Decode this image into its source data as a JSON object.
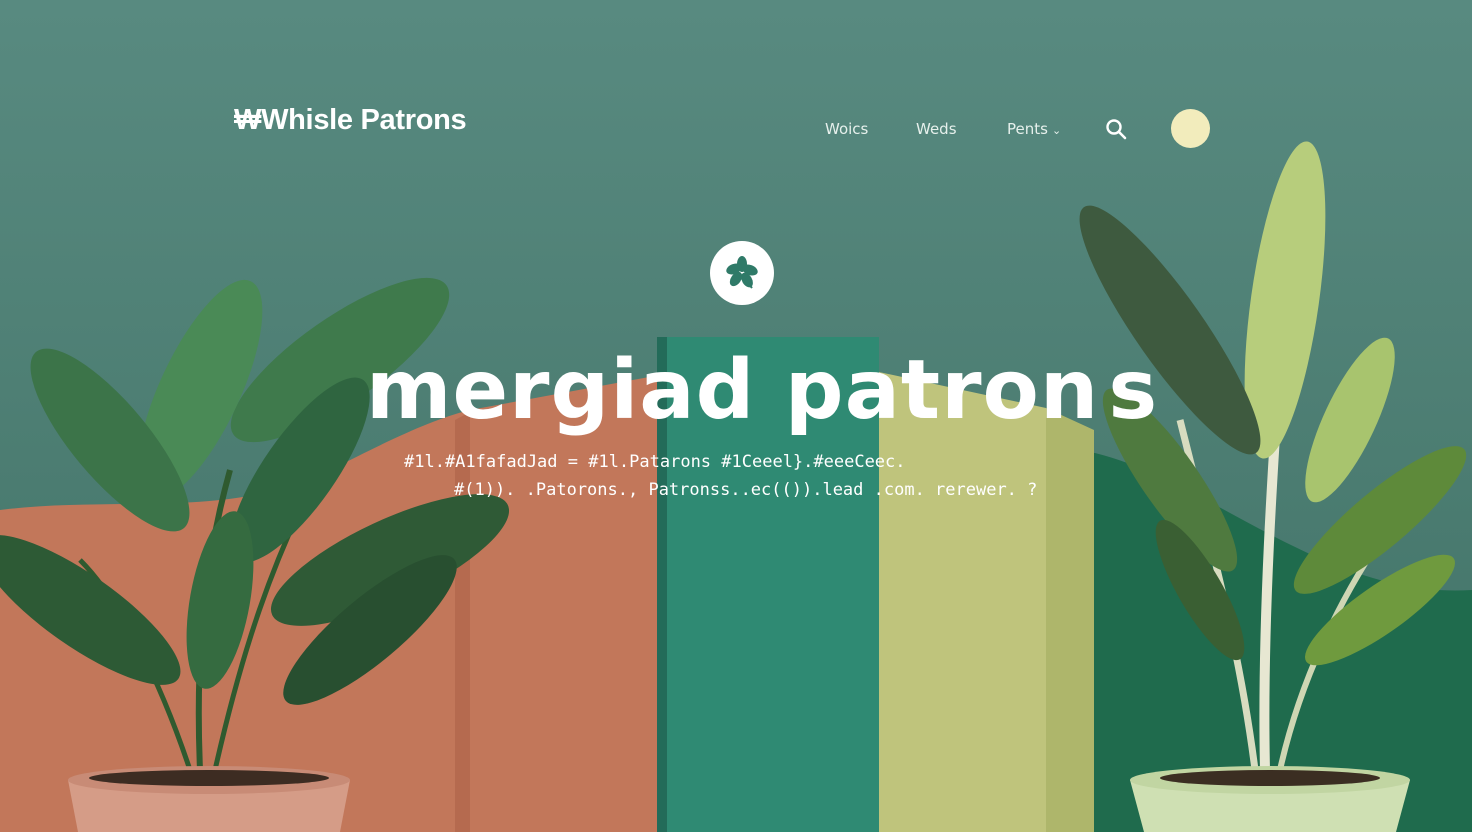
{
  "header": {
    "logo": "₩Whisle Patrons",
    "nav": [
      {
        "label": "Woics"
      },
      {
        "label": "Weds"
      },
      {
        "label": "Pents",
        "has_dropdown": true
      }
    ],
    "search_icon": "search-icon",
    "avatar_color": "#f2ecbc"
  },
  "hero": {
    "badge_icon": "flower-icon",
    "headline": "mergiad patron s",
    "tagline_1": "#1l.#A1fafadJad  = #1l.Patarons #1Ceeel}.#eeeCeec.",
    "tagline_2": "#(1)). .Patorons.,  Patronss..ec(()).lead .com. rerewer. ?"
  },
  "colors": {
    "background": "#4f8076",
    "terracotta": "#c0765a",
    "teal_panel": "#2e8b74",
    "olive_panel": "#bcc27a",
    "deep_green": "#1e6a4c",
    "pot_left": "#d39a85",
    "pot_right": "#cfe1b4"
  }
}
